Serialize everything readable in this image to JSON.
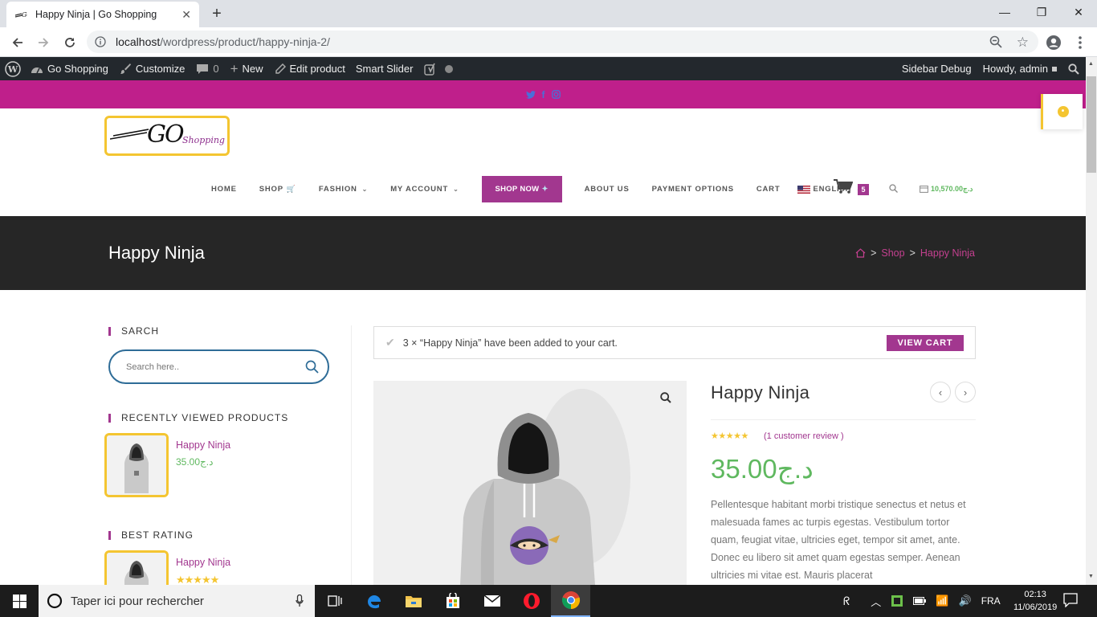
{
  "browser": {
    "tab_title": "Happy Ninja | Go Shopping",
    "new_tab": "+",
    "url_host": "localhost",
    "url_path": "/wordpress/product/happy-ninja-2/"
  },
  "adminbar": {
    "site_name": "Go Shopping",
    "customize": "Customize",
    "comments_count": "0",
    "new": "New",
    "edit_product": "Edit product",
    "smart_slider": "Smart Slider",
    "sidebar_debug": "Sidebar Debug",
    "howdy": "Howdy, admin"
  },
  "logo": {
    "go": "GO",
    "shopping": "Shopping"
  },
  "nav": {
    "home": "HOME",
    "shop": "SHOP",
    "fashion": "FASHION",
    "my_account": "MY ACCOUNT",
    "shop_now": "SHOP NOW",
    "about_us": "ABOUT US",
    "payment_options": "PAYMENT OPTIONS",
    "cart": "CART",
    "language": "ENGLISH",
    "cart_count": "5",
    "mini_cart_total": "10,570.00د.ج"
  },
  "page": {
    "title": "Happy Ninja",
    "breadcrumb_shop": "Shop",
    "breadcrumb_current": "Happy Ninja"
  },
  "sidebar": {
    "search_title": "SARCH",
    "search_placeholder": "Search here..",
    "recent_title": "RECENTLY VIEWED PRODUCTS",
    "recent_product_name": "Happy Ninja",
    "recent_product_price": "35.00د.ج",
    "rating_title": "BEST RATING",
    "rating_product_name": "Happy Ninja"
  },
  "notice": {
    "message": "3 × “Happy Ninja” have been added to your cart.",
    "button": "VIEW CART"
  },
  "product": {
    "title": "Happy Ninja",
    "rating": 5,
    "review_link": "(1 customer review )",
    "price": "35.00د.ج",
    "description": "Pellentesque habitant morbi tristique senectus et netus et malesuada fames ac turpis egestas. Vestibulum tortor quam, feugiat vitae, ultricies eget, tempor sit amet, ante. Donec eu libero sit amet quam egestas semper. Aenean ultricies mi vitae est. Mauris placerat"
  },
  "taskbar": {
    "search_placeholder": "Taper ici pour rechercher",
    "language": "FRA",
    "time": "02:13",
    "date": "11/06/2019"
  },
  "colors": {
    "brand_pink": "#bf1f8b",
    "accent_purple": "#a2378f",
    "price_green": "#5fb85f",
    "logo_yellow": "#f4c531"
  }
}
